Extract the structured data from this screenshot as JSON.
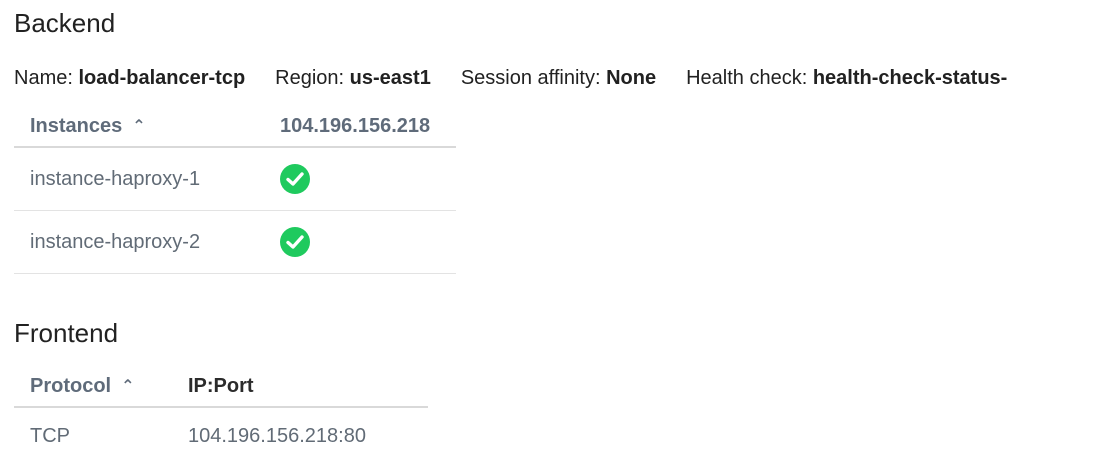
{
  "backend": {
    "title": "Backend",
    "meta": {
      "name_label": "Name:",
      "name_value": "load-balancer-tcp",
      "region_label": "Region:",
      "region_value": "us-east1",
      "affinity_label": "Session affinity:",
      "affinity_value": "None",
      "health_label": "Health check:",
      "health_value": "health-check-status-"
    },
    "table": {
      "headers": [
        "Instances",
        "104.196.156.218"
      ],
      "sort_icon": "chevron-up-icon",
      "rows": [
        {
          "instance": "instance-haproxy-1",
          "status": "healthy"
        },
        {
          "instance": "instance-haproxy-2",
          "status": "healthy"
        }
      ]
    }
  },
  "frontend": {
    "title": "Frontend",
    "table": {
      "headers": [
        "Protocol",
        "IP:Port"
      ],
      "sort_icon": "chevron-up-icon",
      "rows": [
        {
          "protocol": "TCP",
          "ip_port": "104.196.156.218:80"
        }
      ]
    }
  },
  "colors": {
    "healthy_green": "#1fca5e",
    "header_text": "#5f6b7a",
    "cell_text": "#616b76"
  }
}
